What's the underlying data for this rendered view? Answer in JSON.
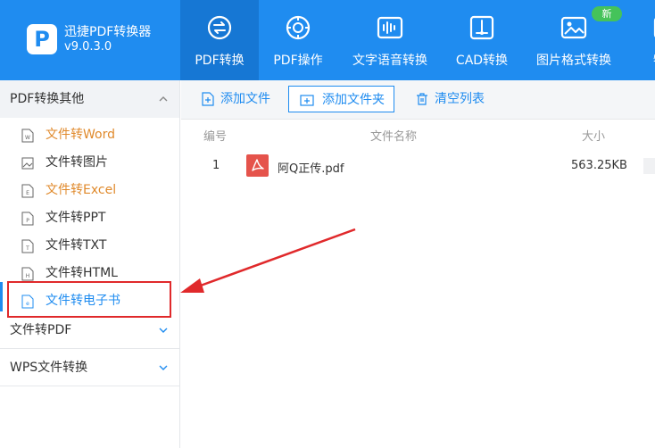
{
  "app": {
    "name": "迅捷PDF转换器",
    "version": "v9.0.3.0",
    "logo_letter": "P"
  },
  "colors": {
    "brand": "#1f8cf0",
    "active_tab": "#1677d4",
    "orange_item": "#e08a2c",
    "annotation_red": "#e0292b",
    "badge_green": "#45c35a"
  },
  "tabs": [
    {
      "label": "PDF转换",
      "icon": "pdf-convert-icon",
      "active": true
    },
    {
      "label": "PDF操作",
      "icon": "pdf-operate-icon",
      "active": false
    },
    {
      "label": "文字语音转换",
      "icon": "audio-wave-icon",
      "active": false
    },
    {
      "label": "CAD转换",
      "icon": "cad-icon",
      "active": false
    },
    {
      "label": "图片格式转换",
      "icon": "image-icon",
      "active": false,
      "badge": "新"
    },
    {
      "label": "特色",
      "icon": "feature-icon",
      "active": false
    }
  ],
  "sidebar": {
    "group1": {
      "label": "PDF转换其他",
      "expanded": true
    },
    "items": [
      {
        "label": "文件转Word",
        "icon": "word-file-icon",
        "color": "orange"
      },
      {
        "label": "文件转图片",
        "icon": "image-file-icon",
        "color": "dark"
      },
      {
        "label": "文件转Excel",
        "icon": "excel-file-icon",
        "color": "orange"
      },
      {
        "label": "文件转PPT",
        "icon": "ppt-file-icon",
        "color": "dark"
      },
      {
        "label": "文件转TXT",
        "icon": "txt-file-icon",
        "color": "dark"
      },
      {
        "label": "文件转HTML",
        "icon": "html-file-icon",
        "color": "dark"
      },
      {
        "label": "文件转电子书",
        "icon": "ebook-file-icon",
        "color": "blue",
        "selected": true
      }
    ],
    "group2": {
      "label": "文件转PDF",
      "expanded": false
    },
    "group3": {
      "label": "WPS文件转换",
      "expanded": false
    }
  },
  "toolbar": {
    "add_file": "添加文件",
    "add_folder": "添加文件夹",
    "clear_list": "清空列表"
  },
  "table": {
    "headers": {
      "index": "编号",
      "name": "文件名称",
      "size": "大小"
    },
    "rows": [
      {
        "index": "1",
        "name": "阿Q正传.pdf",
        "size": "563.25KB",
        "icon": "pdf-file-icon"
      }
    ]
  }
}
